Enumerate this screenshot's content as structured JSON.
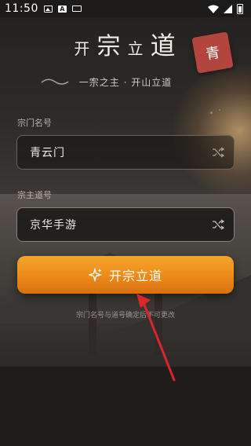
{
  "status_bar": {
    "time": "11:50"
  },
  "header": {
    "title_chars": [
      "开",
      "宗",
      "立",
      "道"
    ],
    "seal_text": "青",
    "subtitle": "一宗之主 · 开山立道"
  },
  "form": {
    "sect_name_label": "宗门名号",
    "sect_name_value": "青云门",
    "master_label": "宗主道号",
    "master_value": "京华手游"
  },
  "submit_button_label": "开宗立道",
  "hint_text": "宗门名号与道号确定后不可更改",
  "colors": {
    "accent": "#f09520",
    "seal": "#b2463f"
  }
}
